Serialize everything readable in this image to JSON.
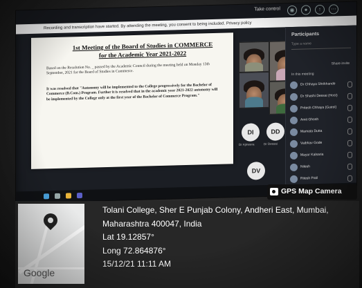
{
  "meeting": {
    "take_control": "Take control",
    "recording_notice": "Recording and transcription have started. By attending the meeting, you consent to being included. Privacy policy"
  },
  "document": {
    "title_line1": "1st Meeting of the Board of Studies in COMMERCE",
    "title_line2": "for the Academic Year 2021-2022",
    "para1": "Based on the Resolution No. _ passed by the Academic Council during the meeting held on Monday 13th September, 2021 for the Board of Studies in Commerce.",
    "para2": "It was resolved that \"Autonomy will be implemented to the College progressively for the Bachelor of Commerce (B.Com.) Program. Further it is resolved that in the academic year 2021-2022 autonomy will be implemented by the College only at the first year of the Bachelor of Commerce Program.\""
  },
  "video_avatars": [
    {
      "initials": "DI",
      "label": "Dr Ajmeera"
    },
    {
      "initials": "DD",
      "label": "Dr Dessai"
    },
    {
      "initials": "DV",
      "label": ""
    }
  ],
  "participants_panel": {
    "title": "Participants",
    "search_placeholder": "Type a name",
    "share_invite": "Share invite",
    "in_meeting": "In this meeting",
    "people": [
      "Dr Chhaya Shrikhande",
      "Dr Shashi Dessai (Host)",
      "Pritesh Chhaya (Guest)",
      "Amit Ghosh",
      "Mamata Dutta",
      "Vaibhav Gode",
      "Mayur Kalsaria",
      "Nilesh",
      "Ritesh Patil"
    ]
  },
  "gps_camera": {
    "label": "GPS Map Camera"
  },
  "location": {
    "address_line1": "Tolani College, Sher E Punjab Colony, Andheri East, Mumbai,",
    "address_line2": "Maharashtra 400047, India",
    "lat": "Lat 19.12857°",
    "long": "Long 72.864876°",
    "datetime": "15/12/21 11:11 AM",
    "map_brand": "Google"
  }
}
